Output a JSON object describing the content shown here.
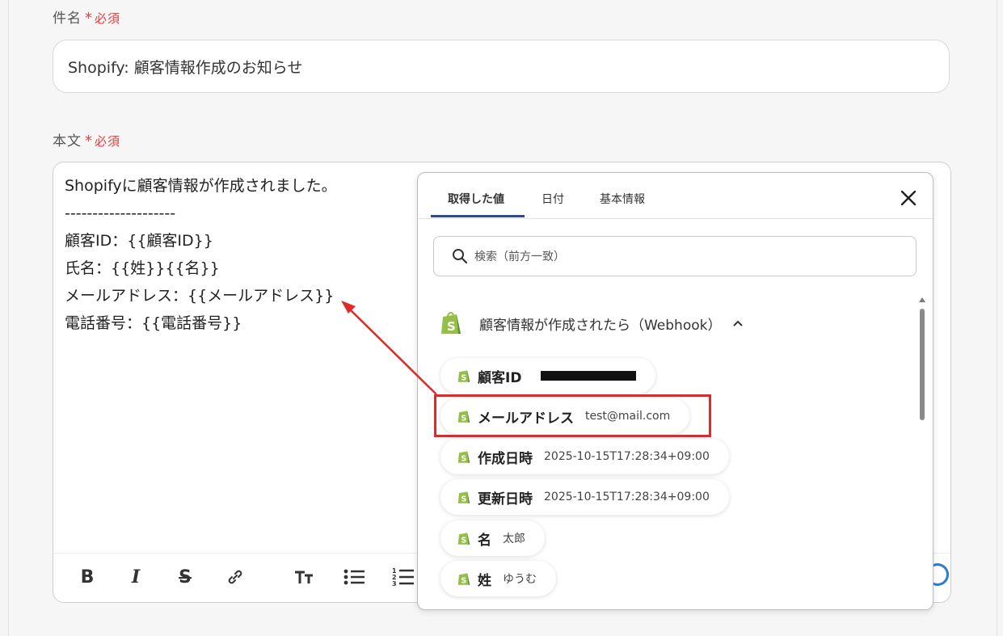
{
  "subject": {
    "label": "件名",
    "required_star": "*",
    "required_text": "必須",
    "value": "Shopify: 顧客情報作成のお知らせ"
  },
  "body": {
    "label": "本文",
    "required_star": "*",
    "required_text": "必須",
    "text": "Shopifyに顧客情報が作成されました。\n--------------------\n顧客ID：{{顧客ID}}\n氏名：{{姓}}{{名}}\nメールアドレス：{{メールアドレス}}\n電話番号：{{電話番号}}"
  },
  "toolbar": {
    "bold": "B",
    "italic": "I",
    "strike": "S",
    "link_icon": "link-icon",
    "heading_icon": "text-size-icon",
    "bullet_icon": "bullet-list-icon",
    "ordered_icon": "numbered-list-icon"
  },
  "popup": {
    "tabs": [
      {
        "label": "取得した値",
        "active": true
      },
      {
        "label": "日付",
        "active": false
      },
      {
        "label": "基本情報",
        "active": false
      }
    ],
    "search_placeholder": "検索（前方一致）",
    "group_title": "顧客情報が作成されたら（Webhook）",
    "items": [
      {
        "key": "顧客ID",
        "value": "",
        "redacted": true
      },
      {
        "key": "メールアドレス",
        "value": "test@mail.com"
      },
      {
        "key": "作成日時",
        "value": "2025-10-15T17:28:34+09:00"
      },
      {
        "key": "更新日時",
        "value": "2025-10-15T17:28:34+09:00"
      },
      {
        "key": "名",
        "value": "太郎"
      },
      {
        "key": "姓",
        "value": "ゆうむ"
      }
    ]
  },
  "colors": {
    "required": "#e53e3e",
    "highlight": "#e02a2a",
    "shopify_green": "#95bf47",
    "tab_underline": "#2d4a8a"
  }
}
